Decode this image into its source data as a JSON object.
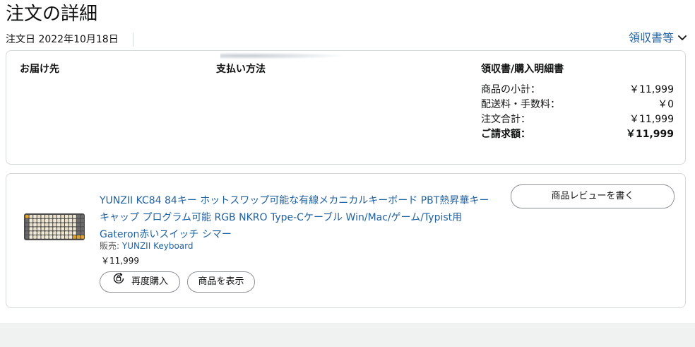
{
  "header": {
    "title": "注文の詳細",
    "order_date": "注文日 2022年10月18日",
    "receipt_link": "領収書等"
  },
  "summary_card": {
    "shipping_heading": "お届け先",
    "payment_heading": "支払い方法",
    "receipt_heading": "領収書/購入明細書",
    "rows": [
      {
        "label": "商品の小計：",
        "value": "￥11,999"
      },
      {
        "label": "配送料・手数料：",
        "value": "￥0"
      },
      {
        "label": "注文合計：",
        "value": "￥11,999"
      },
      {
        "label": "ご請求額：",
        "value": "￥11,999"
      }
    ]
  },
  "item": {
    "title": "YUNZII KC84 84キー ホットスワップ可能な有線メカニカルキーボード PBT熱昇華キーキャップ プログラム可能 RGB NKRO Type-Cケーブル Win/Mac/ゲーム/Typist用 Gateron赤いスイッチ シマー",
    "seller_prefix": "販売:",
    "seller_name": "YUNZII Keyboard",
    "price": "￥11,999",
    "buy_again_label": "再度購入",
    "view_item_label": "商品を表示",
    "review_label": "商品レビューを書く",
    "thumb_icon": "keyboard-thumbnail"
  },
  "colors": {
    "link": "#2162a1",
    "border": "#d5d9d9",
    "text": "#0f1111",
    "secondary_text": "#565959",
    "footer_band": "#f0f2f2"
  },
  "icons": {
    "receipt_chevron": "chevron-down-icon",
    "buy_again": "buy-again-icon"
  }
}
